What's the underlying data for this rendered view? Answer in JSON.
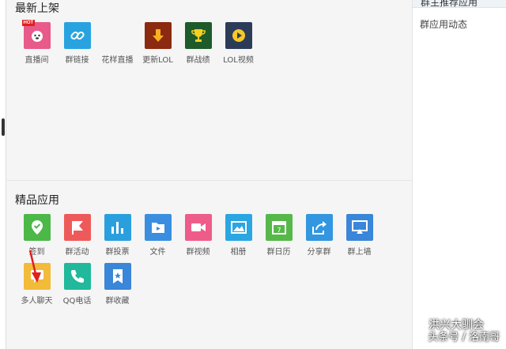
{
  "sections": {
    "newest_title": "最新上架",
    "featured_title": "精品应用"
  },
  "newest_apps": [
    {
      "label": "直播间",
      "icon": "live-room-icon",
      "color": "#e85a8a",
      "badge": "HOT"
    },
    {
      "label": "群链接",
      "icon": "link-icon",
      "color": "#29a3e0"
    },
    {
      "label": "花样直播",
      "icon": "blank-icon",
      "color": "#f5f5f5"
    },
    {
      "label": "更新LOL",
      "icon": "download-icon",
      "color": "#8b2a10"
    },
    {
      "label": "群战绩",
      "icon": "trophy-icon",
      "color": "#1e5a2a"
    },
    {
      "label": "LOL视频",
      "icon": "play-icon",
      "color": "#2c3c58"
    }
  ],
  "featured_apps": [
    {
      "label": "签到",
      "icon": "checkin-icon",
      "color": "#4cb848"
    },
    {
      "label": "群活动",
      "icon": "flag-icon",
      "color": "#ee5a5a"
    },
    {
      "label": "群投票",
      "icon": "bar-chart-icon",
      "color": "#2a9fde"
    },
    {
      "label": "文件",
      "icon": "folder-icon",
      "color": "#3a8ee0"
    },
    {
      "label": "群视频",
      "icon": "video-camera-icon",
      "color": "#ee5c8a"
    },
    {
      "label": "相册",
      "icon": "picture-icon",
      "color": "#2aa6e2"
    },
    {
      "label": "群日历",
      "icon": "calendar-icon",
      "color": "#57b84a"
    },
    {
      "label": "分享群",
      "icon": "share-icon",
      "color": "#3296e0"
    },
    {
      "label": "群上墙",
      "icon": "screen-icon",
      "color": "#3a86d8"
    },
    {
      "label": "多人聊天",
      "icon": "group-chat-icon",
      "color": "#f3bb3a"
    },
    {
      "label": "QQ电话",
      "icon": "phone-icon",
      "color": "#22b89c"
    },
    {
      "label": "群收藏",
      "icon": "bookmark-icon",
      "color": "#3a86d8"
    }
  ],
  "right_panel": {
    "top_title": "群主推荐应用",
    "item": "群应用动态"
  },
  "watermark": {
    "line1": "洪兴大驯会",
    "line2": "头条号 / 洛南哥"
  },
  "colors": {
    "annotation_arrow": "#e0201c"
  }
}
